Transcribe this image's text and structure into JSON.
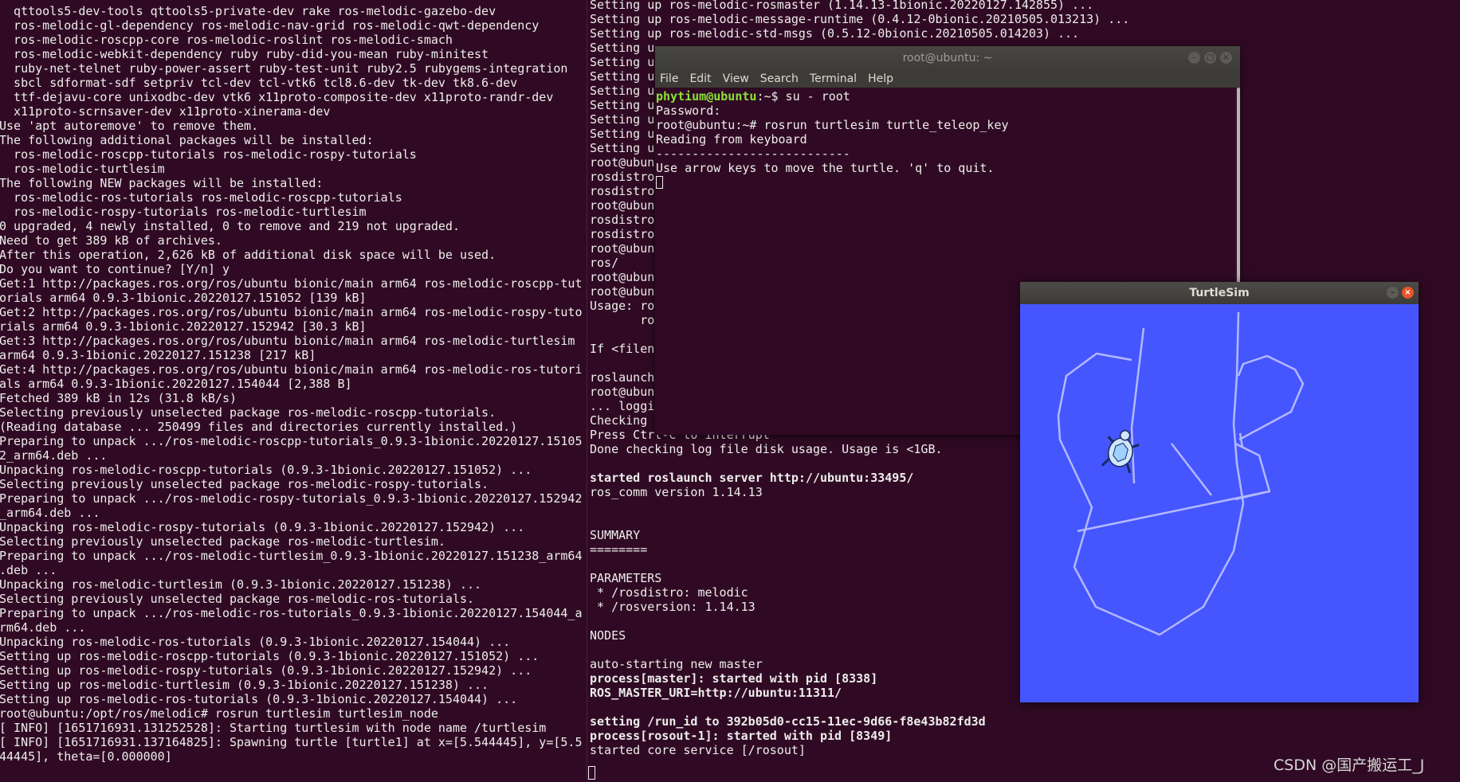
{
  "left_terminal": {
    "lines": [
      "  qttools5-dev-tools qttools5-private-dev rake ros-melodic-gazebo-dev",
      "  ros-melodic-gl-dependency ros-melodic-nav-grid ros-melodic-qwt-dependency",
      "  ros-melodic-roscpp-core ros-melodic-roslint ros-melodic-smach",
      "  ros-melodic-webkit-dependency ruby ruby-did-you-mean ruby-minitest",
      "  ruby-net-telnet ruby-power-assert ruby-test-unit ruby2.5 rubygems-integration",
      "  sbcl sdformat-sdf setpriv tcl-dev tcl-vtk6 tcl8.6-dev tk-dev tk8.6-dev",
      "  ttf-dejavu-core unixodbc-dev vtk6 x11proto-composite-dev x11proto-randr-dev",
      "  x11proto-scrnsaver-dev x11proto-xinerama-dev",
      "Use 'apt autoremove' to remove them.",
      "The following additional packages will be installed:",
      "  ros-melodic-roscpp-tutorials ros-melodic-rospy-tutorials",
      "  ros-melodic-turtlesim",
      "The following NEW packages will be installed:",
      "  ros-melodic-ros-tutorials ros-melodic-roscpp-tutorials",
      "  ros-melodic-rospy-tutorials ros-melodic-turtlesim",
      "0 upgraded, 4 newly installed, 0 to remove and 219 not upgraded.",
      "Need to get 389 kB of archives.",
      "After this operation, 2,626 kB of additional disk space will be used.",
      "Do you want to continue? [Y/n] y",
      "Get:1 http://packages.ros.org/ros/ubuntu bionic/main arm64 ros-melodic-roscpp-tut",
      "orials arm64 0.9.3-1bionic.20220127.151052 [139 kB]",
      "Get:2 http://packages.ros.org/ros/ubuntu bionic/main arm64 ros-melodic-rospy-tuto",
      "rials arm64 0.9.3-1bionic.20220127.152942 [30.3 kB]",
      "Get:3 http://packages.ros.org/ros/ubuntu bionic/main arm64 ros-melodic-turtlesim",
      "arm64 0.9.3-1bionic.20220127.151238 [217 kB]",
      "Get:4 http://packages.ros.org/ros/ubuntu bionic/main arm64 ros-melodic-ros-tutori",
      "als arm64 0.9.3-1bionic.20220127.154044 [2,388 B]",
      "Fetched 389 kB in 12s (31.8 kB/s)",
      "Selecting previously unselected package ros-melodic-roscpp-tutorials.",
      "(Reading database ... 250499 files and directories currently installed.)",
      "Preparing to unpack .../ros-melodic-roscpp-tutorials_0.9.3-1bionic.20220127.15105",
      "2_arm64.deb ...",
      "Unpacking ros-melodic-roscpp-tutorials (0.9.3-1bionic.20220127.151052) ...",
      "Selecting previously unselected package ros-melodic-rospy-tutorials.",
      "Preparing to unpack .../ros-melodic-rospy-tutorials_0.9.3-1bionic.20220127.152942",
      "_arm64.deb ...",
      "Unpacking ros-melodic-rospy-tutorials (0.9.3-1bionic.20220127.152942) ...",
      "Selecting previously unselected package ros-melodic-turtlesim.",
      "Preparing to unpack .../ros-melodic-turtlesim_0.9.3-1bionic.20220127.151238_arm64",
      ".deb ...",
      "Unpacking ros-melodic-turtlesim (0.9.3-1bionic.20220127.151238) ...",
      "Selecting previously unselected package ros-melodic-ros-tutorials.",
      "Preparing to unpack .../ros-melodic-ros-tutorials_0.9.3-1bionic.20220127.154044_a",
      "rm64.deb ...",
      "Unpacking ros-melodic-ros-tutorials (0.9.3-1bionic.20220127.154044) ...",
      "Setting up ros-melodic-roscpp-tutorials (0.9.3-1bionic.20220127.151052) ...",
      "Setting up ros-melodic-rospy-tutorials (0.9.3-1bionic.20220127.152942) ...",
      "Setting up ros-melodic-turtlesim (0.9.3-1bionic.20220127.151238) ...",
      "Setting up ros-melodic-ros-tutorials (0.9.3-1bionic.20220127.154044) ...",
      "root@ubuntu:/opt/ros/melodic# rosrun turtlesim turtlesim_node",
      "[ INFO] [1651716931.131252528]: Starting turtlesim with node name /turtlesim",
      "[ INFO] [1651716931.137164825]: Spawning turtle [turtle1] at x=[5.544445], y=[5.5",
      "44445], theta=[0.000000]"
    ]
  },
  "mid_terminal": {
    "top_partial": "File  Edit  View  Search  Terminal  Help",
    "lines": [
      "Setting up ros-melodic-rosmaster (1.14.13-1bionic.20220127.142855) ...",
      "Setting up ros-melodic-message-runtime (0.4.12-0bionic.20210505.013213) ...",
      "Setting up ros-melodic-std-msgs (0.5.12-0bionic.20210505.014203) ...",
      "Setting u",
      "Setting u",
      "Setting u",
      "Setting u",
      "Setting u",
      "Setting u",
      "Setting u",
      "Setting u",
      "root@ubun",
      "rosdistro                                                                rosmaster",
      "rosdistro                                                                rosversion",
      "root@ubun",
      "rosdistro                                                                rosmaster",
      "rosdistro                                                                rosversion",
      "root@ubun",
      "ros/",
      "root@ubun",
      "root@ubun",
      "Usage: ros",
      "       ros",
      "",
      "If <filena",
      "",
      "roslaunch",
      "root@ubun",
      "... loggi",
      "Checking ",
      "Press Ctrl-C to interrupt",
      "Done checking log file disk usage. Usage is <1GB.",
      "",
      "started roslaunch server http://ubuntu:33495/",
      "ros_comm version 1.14.13",
      "",
      "",
      "SUMMARY",
      "========",
      "",
      "PARAMETERS",
      " * /rosdistro: melodic",
      " * /rosversion: 1.14.13",
      "",
      "NODES",
      "",
      "auto-starting new master",
      "process[master]: started with pid [8338]",
      "ROS_MASTER_URI=http://ubuntu:11311/",
      "",
      "setting /run_id to 392b05d0-cc15-11ec-9d66-f8e43b82fd3d",
      "process[rosout-1]: started with pid [8349]",
      "started core service [/rosout]"
    ]
  },
  "root_window": {
    "title": "root@ubuntu: ~",
    "menu": [
      "File",
      "Edit",
      "View",
      "Search",
      "Terminal",
      "Help"
    ],
    "prompt_user": "phytium@ubuntu",
    "prompt_rest": ":~$ su - root",
    "lines": [
      "Password:",
      "root@ubuntu:~# rosrun turtlesim turtle_teleop_key",
      "Reading from keyboard",
      "---------------------------",
      "Use arrow keys to move the turtle. 'q' to quit."
    ]
  },
  "turtlesim": {
    "title": "TurtleSim",
    "background": "#4556ff",
    "pen_color": "#b3b8ff"
  },
  "watermark": "CSDN @国产搬运工_J",
  "colors": {
    "terminal_bg": "#300a24",
    "prompt_green": "#8ae234"
  }
}
